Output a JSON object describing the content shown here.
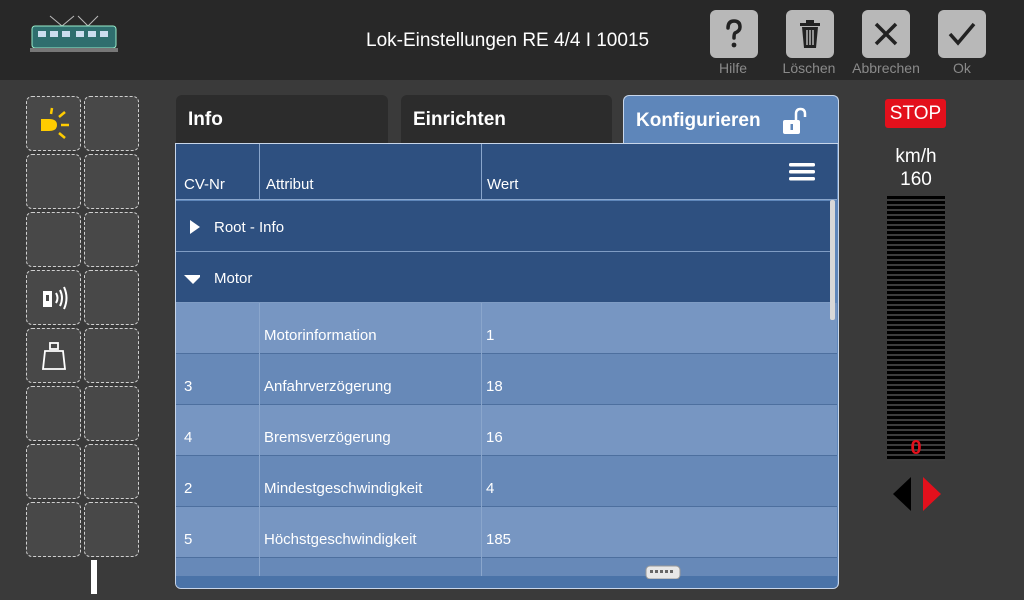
{
  "header": {
    "title": "Lok-Einstellungen RE 4/4 I 10015",
    "buttons": [
      {
        "label": "Hilfe",
        "icon": "question-icon"
      },
      {
        "label": "Löschen",
        "icon": "trash-icon"
      },
      {
        "label": "Abbrechen",
        "icon": "close-icon"
      },
      {
        "label": "Ok",
        "icon": "check-icon"
      }
    ]
  },
  "tabs": [
    {
      "label": "Info",
      "active": false
    },
    {
      "label": "Einrichten",
      "active": false
    },
    {
      "label": "Konfigurieren",
      "active": true
    }
  ],
  "table": {
    "columns": [
      "CV-Nr",
      "Attribut",
      "Wert"
    ],
    "groups": [
      {
        "label": "Root - Info",
        "expanded": false
      },
      {
        "label": "Motor",
        "expanded": true
      }
    ],
    "rows": [
      {
        "cv": "",
        "attr": "Motorinformation",
        "value": "1"
      },
      {
        "cv": "3",
        "attr": "Anfahrverzögerung",
        "value": "18"
      },
      {
        "cv": "4",
        "attr": "Bremsverzögerung",
        "value": "16"
      },
      {
        "cv": "2",
        "attr": "Mindestgeschwindigkeit",
        "value": "4"
      },
      {
        "cv": "5",
        "attr": "Höchstgeschwindigkeit",
        "value": "185"
      }
    ]
  },
  "control": {
    "stop_label": "STOP",
    "unit": "km/h",
    "max_speed": "160",
    "current_speed": "0"
  },
  "colors": {
    "accent": "#5e86ba",
    "header_row": "#2e5080",
    "stop": "#e3101c",
    "light_icon": "#ffcc00"
  }
}
